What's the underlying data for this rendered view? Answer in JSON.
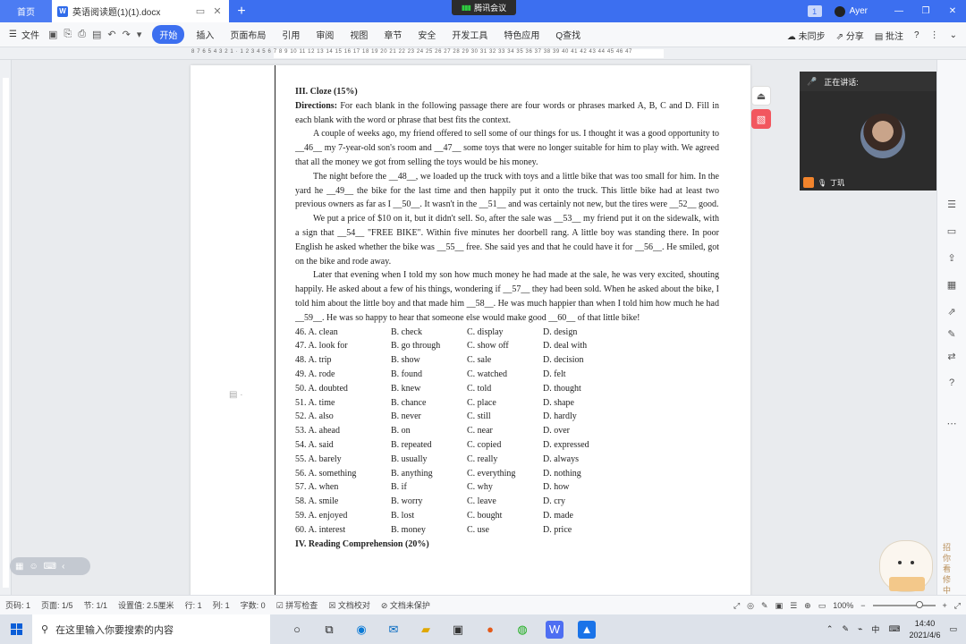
{
  "titlebar": {
    "home_tab": "首页",
    "doc_tab": "英语阅读题(1)(1).docx",
    "meeting": "腾讯会议",
    "badge": "1",
    "user": "Ayer"
  },
  "ribbon": {
    "file": "文件",
    "tabs": [
      "开始",
      "插入",
      "页面布局",
      "引用",
      "审阅",
      "视图",
      "章节",
      "安全",
      "开发工具",
      "特色应用",
      "Q查找"
    ],
    "active_tab": "开始",
    "sync": "未同步",
    "share": "分享",
    "comment": "批注"
  },
  "ruler": {
    "numbers": "8 7 6 5 4 3 2 1 · 1 2 3 4 5 6 7 8 9 10 11 12 13 14 15 16 17 18 19 20 21 22 23 24 25 26 27 28 29 30 31 32 33 34 35 36 37 38 39 40 41 42 43 44 45 46 47"
  },
  "document": {
    "heading": "III. Cloze (15%)",
    "directions_label": "Directions:",
    "directions": " For each blank in the following passage there are four words or phrases marked A, B, C and D. Fill in each blank with the word or phrase that best fits the context.",
    "para1": "A couple of weeks ago, my friend offered to sell some of our things for us. I thought it was a good opportunity to __46__ my 7-year-old son's room and __47__ some toys that were no longer suitable for him to play with. We agreed that all the money we got from selling the toys would be his money.",
    "para2": "The night before the __48__, we loaded up the truck with toys and a little bike that was too small for him. In the yard he __49__ the bike for the last time and then happily put it onto the truck. This little bike had at least two previous owners as far as I __50__. It wasn't in the __51__ and was certainly not new, but the tires were __52__ good.",
    "para3": "We put a price of $10 on it, but it didn't sell. So, after the sale was __53__ my friend put it on the sidewalk, with a sign that __54__ \"FREE BIKE\". Within five minutes her doorbell rang. A little boy was standing there. In poor English he asked whether the bike was __55__ free. She said yes and that he could have it for __56__. He smiled, got on the bike and rode away.",
    "para4": "Later that evening when I told my son how much money he had made at the sale, he was very excited, shouting happily. He asked about a few of his things, wondering if __57__ they had been sold. When he asked about the bike, I told him about the little boy and that made him __58__. He was much happier than when I told him how much he had __59__. He was so happy to hear that someone else would make good __60__ of that little bike!",
    "options": [
      [
        "46. A. clean",
        "B. check",
        "C. display",
        "D. design"
      ],
      [
        "47. A. look for",
        "B. go through",
        "C. show off",
        "D. deal with"
      ],
      [
        "48. A. trip",
        "B. show",
        "C. sale",
        "D. decision"
      ],
      [
        "49. A. rode",
        "B. found",
        "C. watched",
        "D. felt"
      ],
      [
        "50. A. doubted",
        "B. knew",
        "C. told",
        "D. thought"
      ],
      [
        "51. A. time",
        "B. chance",
        "C. place",
        "D. shape"
      ],
      [
        "52. A. also",
        "B. never",
        "C. still",
        "D. hardly"
      ],
      [
        "53. A. ahead",
        "B. on",
        "C. near",
        "D. over"
      ],
      [
        "54. A. said",
        "B. repeated",
        "C. copied",
        "D. expressed"
      ],
      [
        "55. A. barely",
        "B. usually",
        "C. really",
        "D. always"
      ],
      [
        "56. A. something",
        "B. anything",
        "C. everything",
        "D. nothing"
      ],
      [
        "57. A. when",
        "B. if",
        "C. why",
        "D. how"
      ],
      [
        "58. A. smile",
        "B. worry",
        "C. leave",
        "D. cry"
      ],
      [
        "59. A. enjoyed",
        "B. lost",
        "C. bought",
        "D. made"
      ],
      [
        "60. A. interest",
        "B. money",
        "C. use",
        "D. price"
      ]
    ],
    "heading2": "IV. Reading Comprehension (20%)"
  },
  "video": {
    "speaking": "正在讲话:",
    "name": "丁玑"
  },
  "statusbar": {
    "items": [
      "页码: 1",
      "页面: 1/5",
      "节: 1/1",
      "设置值: 2.5厘米",
      "行: 1",
      "列: 1",
      "字数: 0",
      "拼写检查",
      "文档校对",
      "文档未保护"
    ],
    "zoom": "100%"
  },
  "mascot_text": "招你看修中",
  "taskbar": {
    "search_placeholder": "在这里输入你要搜索的内容",
    "time": "14:40",
    "date": "2021/4/6",
    "ime": "中"
  },
  "colors": {
    "title_blue": "#3c6ff0",
    "pdf_red": "#f2575f"
  }
}
